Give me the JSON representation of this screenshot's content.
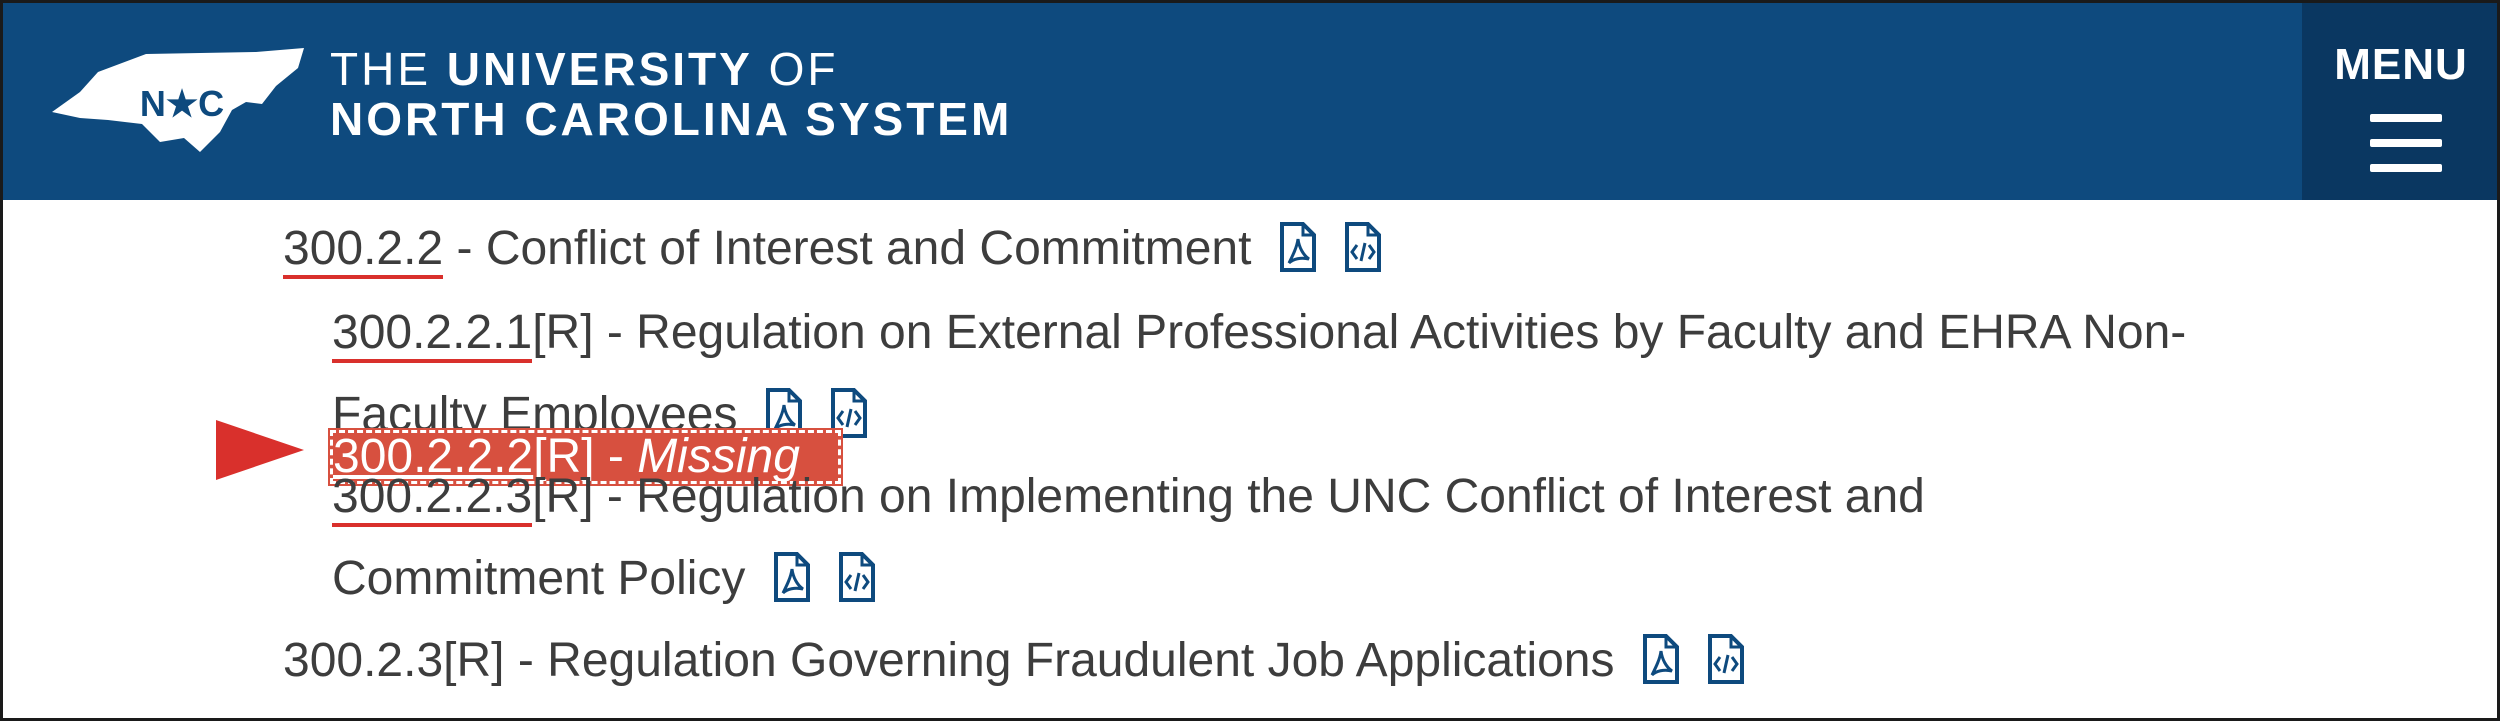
{
  "header": {
    "brand_line1_prefix": "THE ",
    "brand_line1_bold": "UNIVERSITY",
    "brand_line1_suffix": " OF",
    "brand_line2": "NORTH CAROLINA SYSTEM",
    "logo_text": "N★C",
    "menu_label": "MENU",
    "background_color": "#0e4a7e",
    "menu_background_color": "#0a3761"
  },
  "policies": [
    {
      "number": "300.2.2",
      "title": " - Conflict of Interest and Commitment"
    },
    {
      "number": "300.2.2.1",
      "title_line1": "[R] - Regulation on External Professional Activities by Faculty and EHRA Non-",
      "title_line2": "Faculty Employees"
    },
    {
      "number": "300.2.2.2",
      "rest": "[R] - ",
      "missing_label": "Missing"
    },
    {
      "number": "300.2.2.3",
      "title_line1": "[R] - Regulation on Implementing the UNC Conflict of Interest and",
      "title_line2": "Commitment Policy"
    },
    {
      "number": "300.2.3",
      "title": "[R] - Regulation Governing Fraudulent Job Applications"
    }
  ],
  "icons": {
    "pdf": "pdf-file-icon",
    "html": "code-file-icon",
    "missing_marker": "red-arrow-icon"
  },
  "colors": {
    "accent_red": "#d9302c",
    "missing_highlight": "#d7503f",
    "icon_blue": "#0e4a7e",
    "text": "#3d3d3d"
  }
}
